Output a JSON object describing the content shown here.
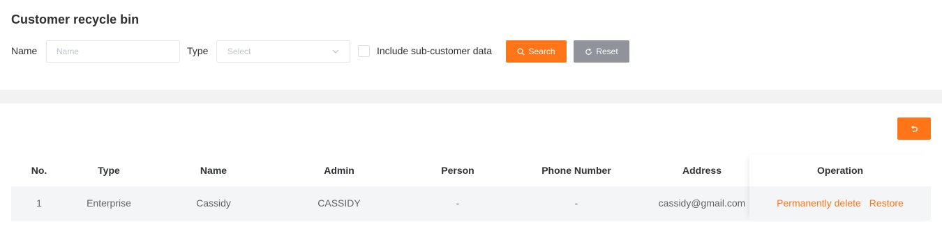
{
  "page": {
    "title": "Customer recycle bin"
  },
  "filters": {
    "name_label": "Name",
    "name_placeholder": "Name",
    "type_label": "Type",
    "type_placeholder": "Select",
    "include_sub_label": "Include sub-customer data",
    "include_sub_checked": false,
    "search_label": "Search",
    "reset_label": "Reset"
  },
  "colors": {
    "accent": "#ff7518",
    "reset": "#909399",
    "row_bg": "#f4f5f7"
  },
  "icons": {
    "search": "search-icon",
    "reset": "refresh-icon",
    "undo": "undo-icon",
    "chevron": "chevron-down-icon"
  },
  "table": {
    "columns": [
      "No.",
      "Type",
      "Name",
      "Admin",
      "Person",
      "Phone Number",
      "Address",
      "Operation"
    ],
    "rows": [
      {
        "no": "1",
        "type": "Enterprise",
        "name": "Cassidy",
        "admin": "CASSIDY",
        "person": "-",
        "phone": "-",
        "address": "cassidy@gmail.com",
        "actions": {
          "delete": "Permanently delete",
          "restore": "Restore"
        }
      }
    ]
  }
}
